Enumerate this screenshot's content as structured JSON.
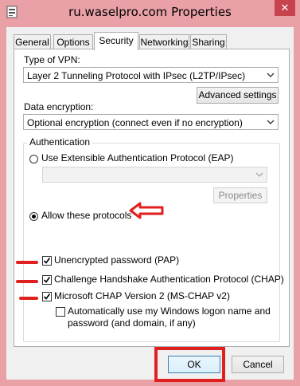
{
  "window": {
    "title": "ru.waselpro.com Properties",
    "close_glyph": "✕"
  },
  "tabs": [
    {
      "label": "General"
    },
    {
      "label": "Options"
    },
    {
      "label": "Security",
      "active": true
    },
    {
      "label": "Networking"
    },
    {
      "label": "Sharing"
    }
  ],
  "security": {
    "vpn_type_label": "Type of VPN:",
    "vpn_type_value": "Layer 2 Tunneling Protocol with IPsec (L2TP/IPsec)",
    "advanced_settings_label": "Advanced settings",
    "encryption_label": "Data encryption:",
    "encryption_value": "Optional encryption (connect even if no encryption)",
    "auth_group_label": "Authentication",
    "eap_option_label": "Use Extensible Authentication Protocol (EAP)",
    "eap_selected": false,
    "eap_select_value": "",
    "properties_label": "Properties",
    "allow_option_label": "Allow these protocols",
    "allow_selected": true,
    "protocols": [
      {
        "label": "Unencrypted password (PAP)",
        "checked": true
      },
      {
        "label": "Challenge Handshake Authentication Protocol (CHAP)",
        "checked": true
      },
      {
        "label": "Microsoft CHAP Version 2 (MS-CHAP v2)",
        "checked": true
      }
    ],
    "auto_logon_label_line1": "Automatically use my Windows logon name and",
    "auto_logon_label_line2": "password (and domain, if any)",
    "auto_logon_checked": false
  },
  "footer": {
    "ok_label": "OK",
    "cancel_label": "Cancel"
  },
  "colors": {
    "window_frame": "#e9a0a6",
    "annotation_red": "#e0201f",
    "close_button": "#c7434e"
  },
  "icons": {
    "title_icon": "network-connection-icon",
    "chevron": "chevron-down-icon"
  }
}
